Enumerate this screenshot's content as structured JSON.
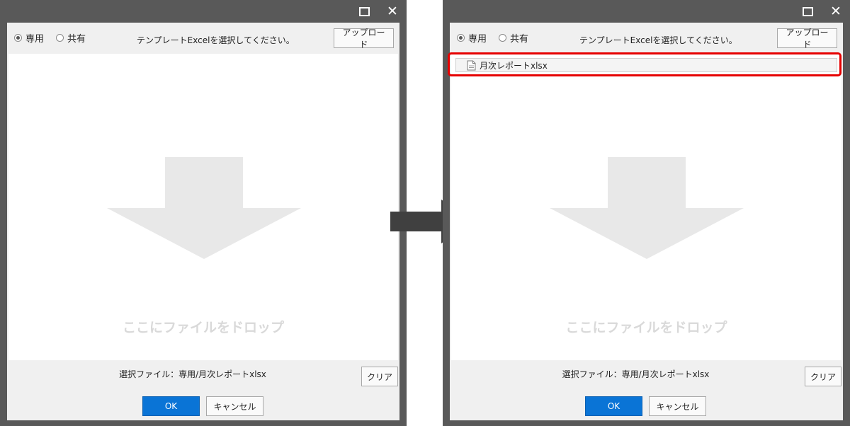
{
  "colors": {
    "window_frame": "#595959",
    "ok_button": "#0a74d6",
    "highlight": "#e60000",
    "drop_arrow": "#e8e8e8",
    "flow_arrow": "#404040"
  },
  "icons": {
    "maximize": "maximize-icon",
    "close": "close-icon",
    "drop_arrow": "down-arrow-icon",
    "file": "file-icon",
    "flow": "right-arrow-icon"
  },
  "left_dialog": {
    "radio_dedicated": "専用",
    "radio_shared": "共有",
    "radio_selected": "dedicated",
    "instruction": "テンプレートExcelを選択してください。",
    "upload_label": "アップロード",
    "drop_text": "ここにファイルをドロップ",
    "selected_file": "選択ファイル：専用/月次レポートxlsx",
    "clear_label": "クリア",
    "ok_label": "OK",
    "cancel_label": "キャンセル"
  },
  "right_dialog": {
    "radio_dedicated": "専用",
    "radio_shared": "共有",
    "radio_selected": "dedicated",
    "instruction": "テンプレートExcelを選択してください。",
    "upload_label": "アップロード",
    "files": [
      {
        "name": "月次レポートxlsx"
      }
    ],
    "drop_text": "ここにファイルをドロップ",
    "selected_file": "選択ファイル：専用/月次レポートxlsx",
    "clear_label": "クリア",
    "ok_label": "OK",
    "cancel_label": "キャンセル"
  }
}
